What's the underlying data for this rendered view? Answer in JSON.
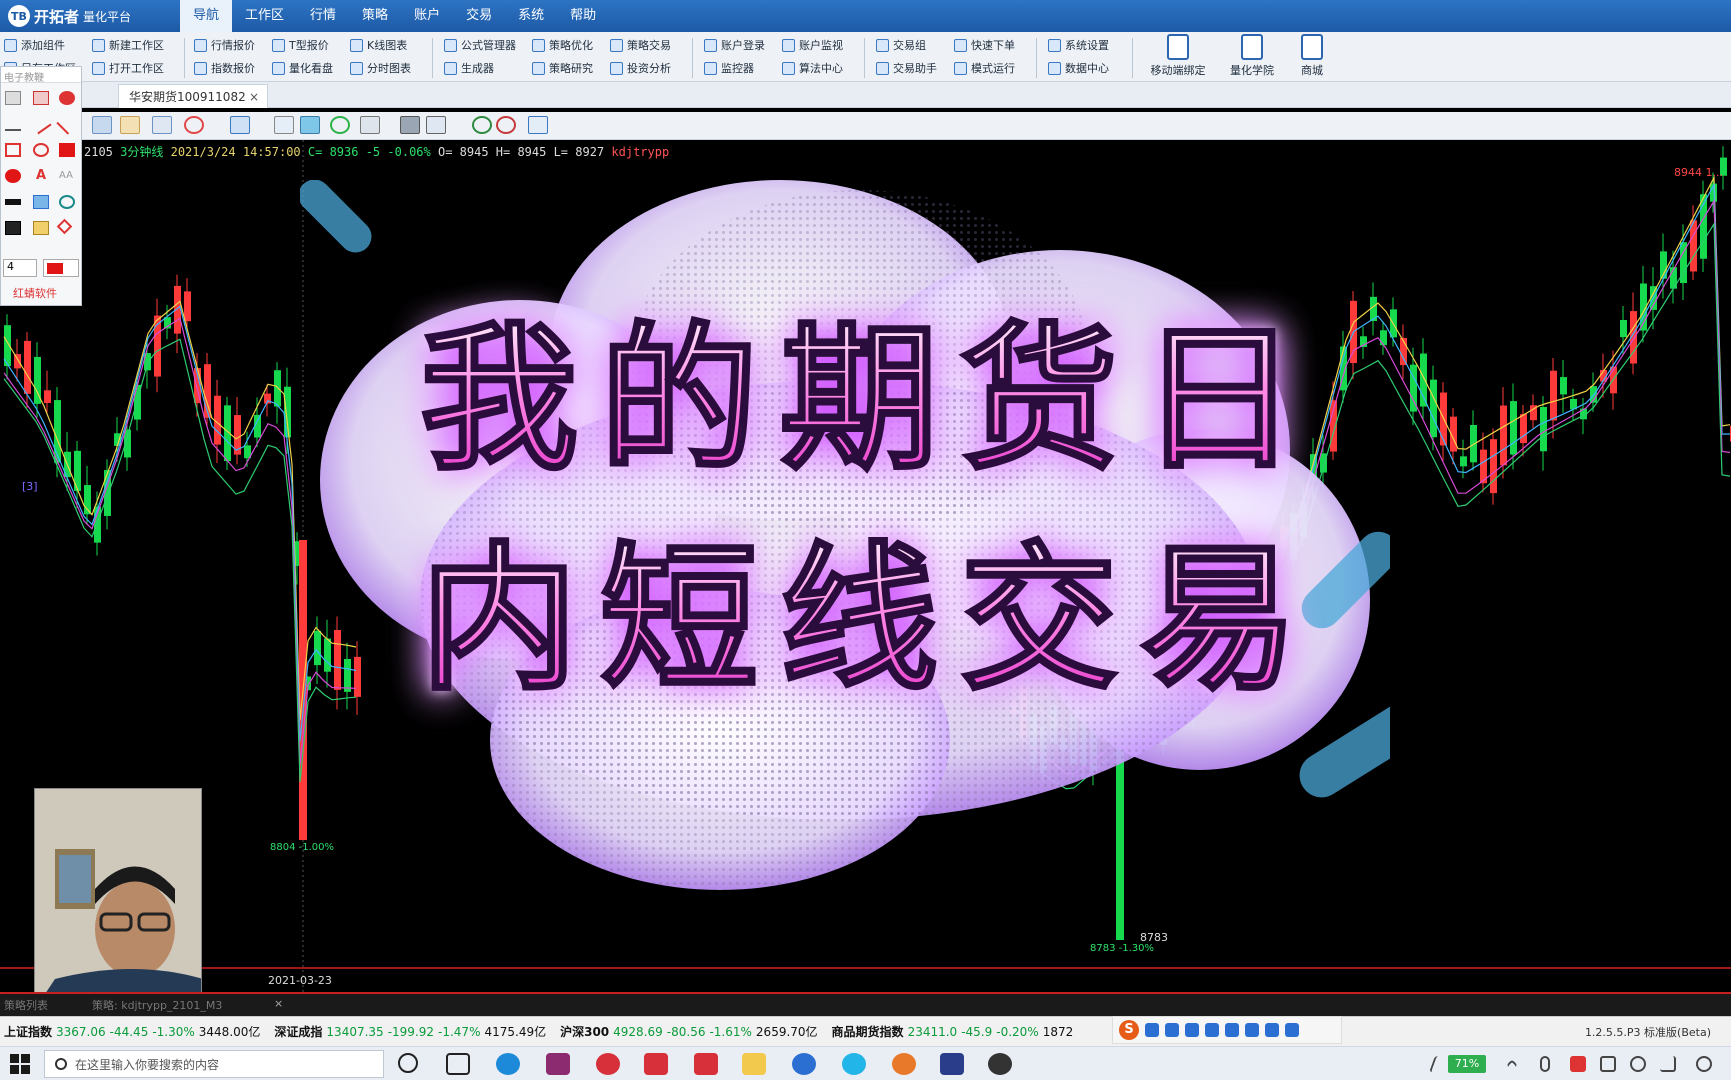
{
  "app": {
    "logo_text": "开拓者",
    "logo_sub": "量化平台",
    "version": "1.2.5.5.P3 标准版(Beta)"
  },
  "menu": [
    "导航",
    "工作区",
    "行情",
    "策略",
    "账户",
    "交易",
    "系统",
    "帮助"
  ],
  "ribbon": {
    "row1": [
      "添加组件",
      "新建工作区",
      "行情报价",
      "T型报价",
      "K线图表",
      "公式管理器",
      "策略优化",
      "策略交易",
      "账户登录",
      "账户监视",
      "交易组",
      "快速下单",
      "系统设置"
    ],
    "row2": [
      "另存工作区",
      "打开工作区",
      "指数报价",
      "量化看盘",
      "分时图表",
      "生成器",
      "策略研究",
      "投资分析",
      "监控器",
      "算法中心",
      "交易助手",
      "模式运行",
      "数据中心"
    ],
    "big": [
      "移动端绑定",
      "量化学院",
      "商城"
    ]
  },
  "tab": {
    "label": "华安期货100911082",
    "close": "×"
  },
  "toolbox": {
    "title": "电子教鞭",
    "size_value": "4",
    "footer": "红蜻软件"
  },
  "chart_info": {
    "symbol": "2105",
    "period": "3分钟线",
    "datetime": "2021/3/24 14:57:00",
    "close_text": "C= 8936",
    "change": "-5",
    "change_pct": "-0.06%",
    "ohl": "O= 8945 H= 8945 L= 8927",
    "indicator": "kdjtrypp"
  },
  "labels": {
    "max": "8944 1...",
    "low_left": "8804 -1.00%",
    "low_value": "8783",
    "low_right": "8783 -1.30%",
    "date": "2021-03-23",
    "marker": "[3]"
  },
  "overlay_title": {
    "line1": "我的期货日",
    "line2": "内短线交易"
  },
  "strategy_tabs": [
    "策略列表",
    "策略: kdjtrypp_2101_M3",
    "×"
  ],
  "ticker": {
    "items": [
      {
        "name": "上证指数",
        "v1": "3367.06",
        "v2": "-44.45",
        "v3": "-1.30%",
        "v4": "3448.00亿"
      },
      {
        "name": "深证成指",
        "v1": "13407.35",
        "v2": "-199.92",
        "v3": "-1.47%",
        "v4": "4175.49亿"
      },
      {
        "name": "沪深300",
        "v1": "4928.69",
        "v2": "-80.56",
        "v3": "-1.61%",
        "v4": "2659.70亿"
      },
      {
        "name": "商品期货指数",
        "v1": "23411.0",
        "v2": "-45.9",
        "v3": "-0.20%",
        "v4": "1872"
      }
    ]
  },
  "taskbar": {
    "search_placeholder": "在这里输入你要搜索的内容",
    "battery": "71%"
  },
  "colors": {
    "up": "#ff3a3a",
    "down": "#16d94e",
    "ma1": "#f0d24a",
    "ma2": "#3fb5ff",
    "ma3": "#d64bd6",
    "ma4": "#2ecc71"
  }
}
